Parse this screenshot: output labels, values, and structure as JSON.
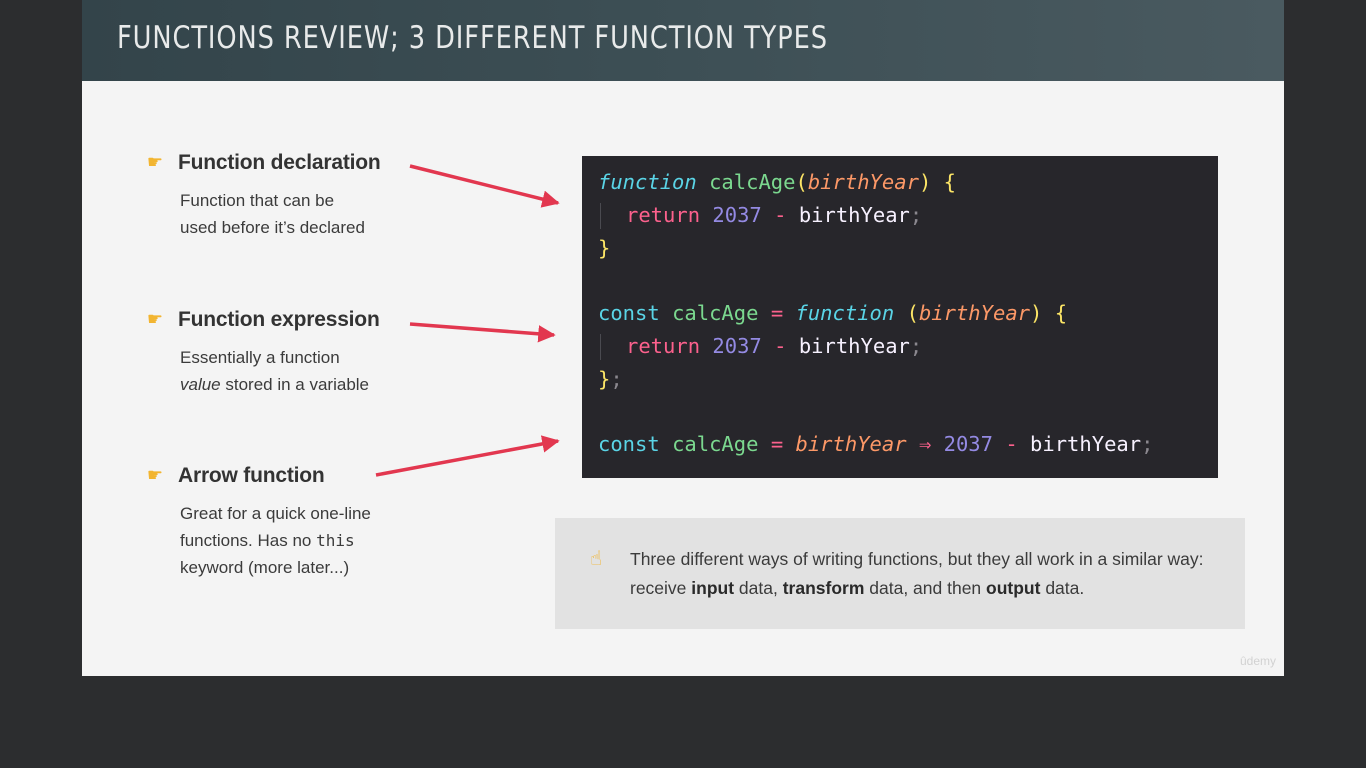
{
  "slide": {
    "title": "FUNCTIONS REVIEW; 3 DIFFERENT FUNCTION TYPES",
    "watermark": "ûdemy"
  },
  "points": [
    {
      "icon": "pointing-hand-icon",
      "label": "Function declaration",
      "desc_line1": "Function that can be",
      "desc_line2": "used before it’s declared"
    },
    {
      "icon": "pointing-hand-icon",
      "label": "Function expression",
      "desc_line1": "Essentially a function",
      "desc_line2_em": "value",
      "desc_line2_rest": " stored in a variable"
    },
    {
      "icon": "pointing-hand-icon",
      "label": "Arrow function",
      "desc_line1": "Great for a quick one-line",
      "desc_line2_pre": "functions. Has no ",
      "desc_line2_code": "this",
      "desc_line3": "keyword (more later...)"
    }
  ],
  "code": {
    "declaration": {
      "kw": "function",
      "name": "calcAge",
      "open_paren": "(",
      "param": "birthYear",
      "close_paren": ")",
      "open_brace": "{",
      "ret": "return",
      "num": "2037",
      "op": "-",
      "ident": "birthYear",
      "semi": ";",
      "close_brace": "}"
    },
    "expression": {
      "const": "const",
      "name": "calcAge",
      "eq": "=",
      "kw": "function",
      "open_paren": "(",
      "param": "birthYear",
      "close_paren": ")",
      "open_brace": "{",
      "ret": "return",
      "num": "2037",
      "op": "-",
      "ident": "birthYear",
      "semi": ";",
      "close_brace": "}",
      "close_semi": ";"
    },
    "arrow": {
      "const": "const",
      "name": "calcAge",
      "eq": "=",
      "param": "birthYear",
      "arrow": "⇒",
      "num": "2037",
      "op": "-",
      "ident": "birthYear",
      "semi": ";"
    }
  },
  "note": {
    "icon": "pointing-up-hand-icon",
    "text_1": "Three different ways of writing functions, but they all work in a similar way: receive ",
    "bold_1": "input",
    "text_2": " data, ",
    "bold_2": "transform",
    "text_3": " data, and then ",
    "bold_3": "output",
    "text_4": " data."
  },
  "colors": {
    "arrow": "#e2374f",
    "hand_icon": "#f2b531",
    "code_bg": "#27262b"
  }
}
